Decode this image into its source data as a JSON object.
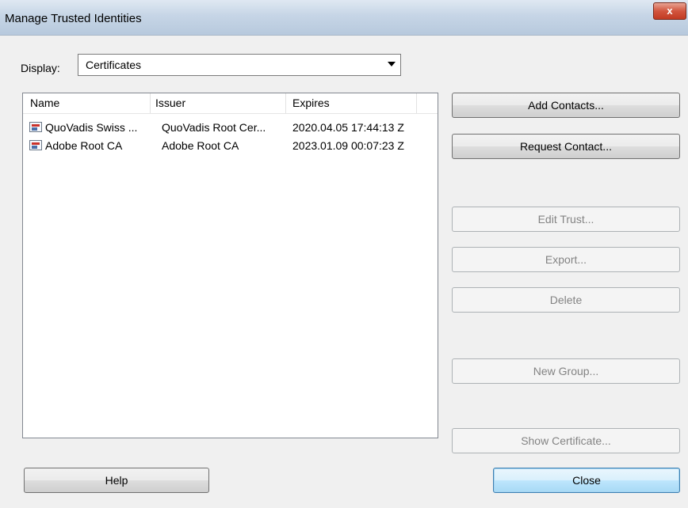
{
  "window": {
    "title": "Manage Trusted Identities",
    "close_glyph": "x"
  },
  "display": {
    "label": "Display:",
    "selected": "Certificates"
  },
  "list": {
    "columns": [
      "Name",
      "Issuer",
      "Expires"
    ],
    "rows": [
      {
        "name": "QuoVadis Swiss ...",
        "issuer": "QuoVadis Root Cer...",
        "expires": "2020.04.05 17:44:13 Z"
      },
      {
        "name": "Adobe Root CA",
        "issuer": "Adobe Root CA",
        "expires": "2023.01.09 00:07:23 Z"
      }
    ]
  },
  "buttons": {
    "add_contacts": "Add Contacts...",
    "request_contact": "Request Contact...",
    "edit_trust": "Edit Trust...",
    "export": "Export...",
    "delete": "Delete",
    "new_group": "New Group...",
    "show_certificate": "Show Certificate...",
    "help": "Help",
    "close": "Close"
  }
}
